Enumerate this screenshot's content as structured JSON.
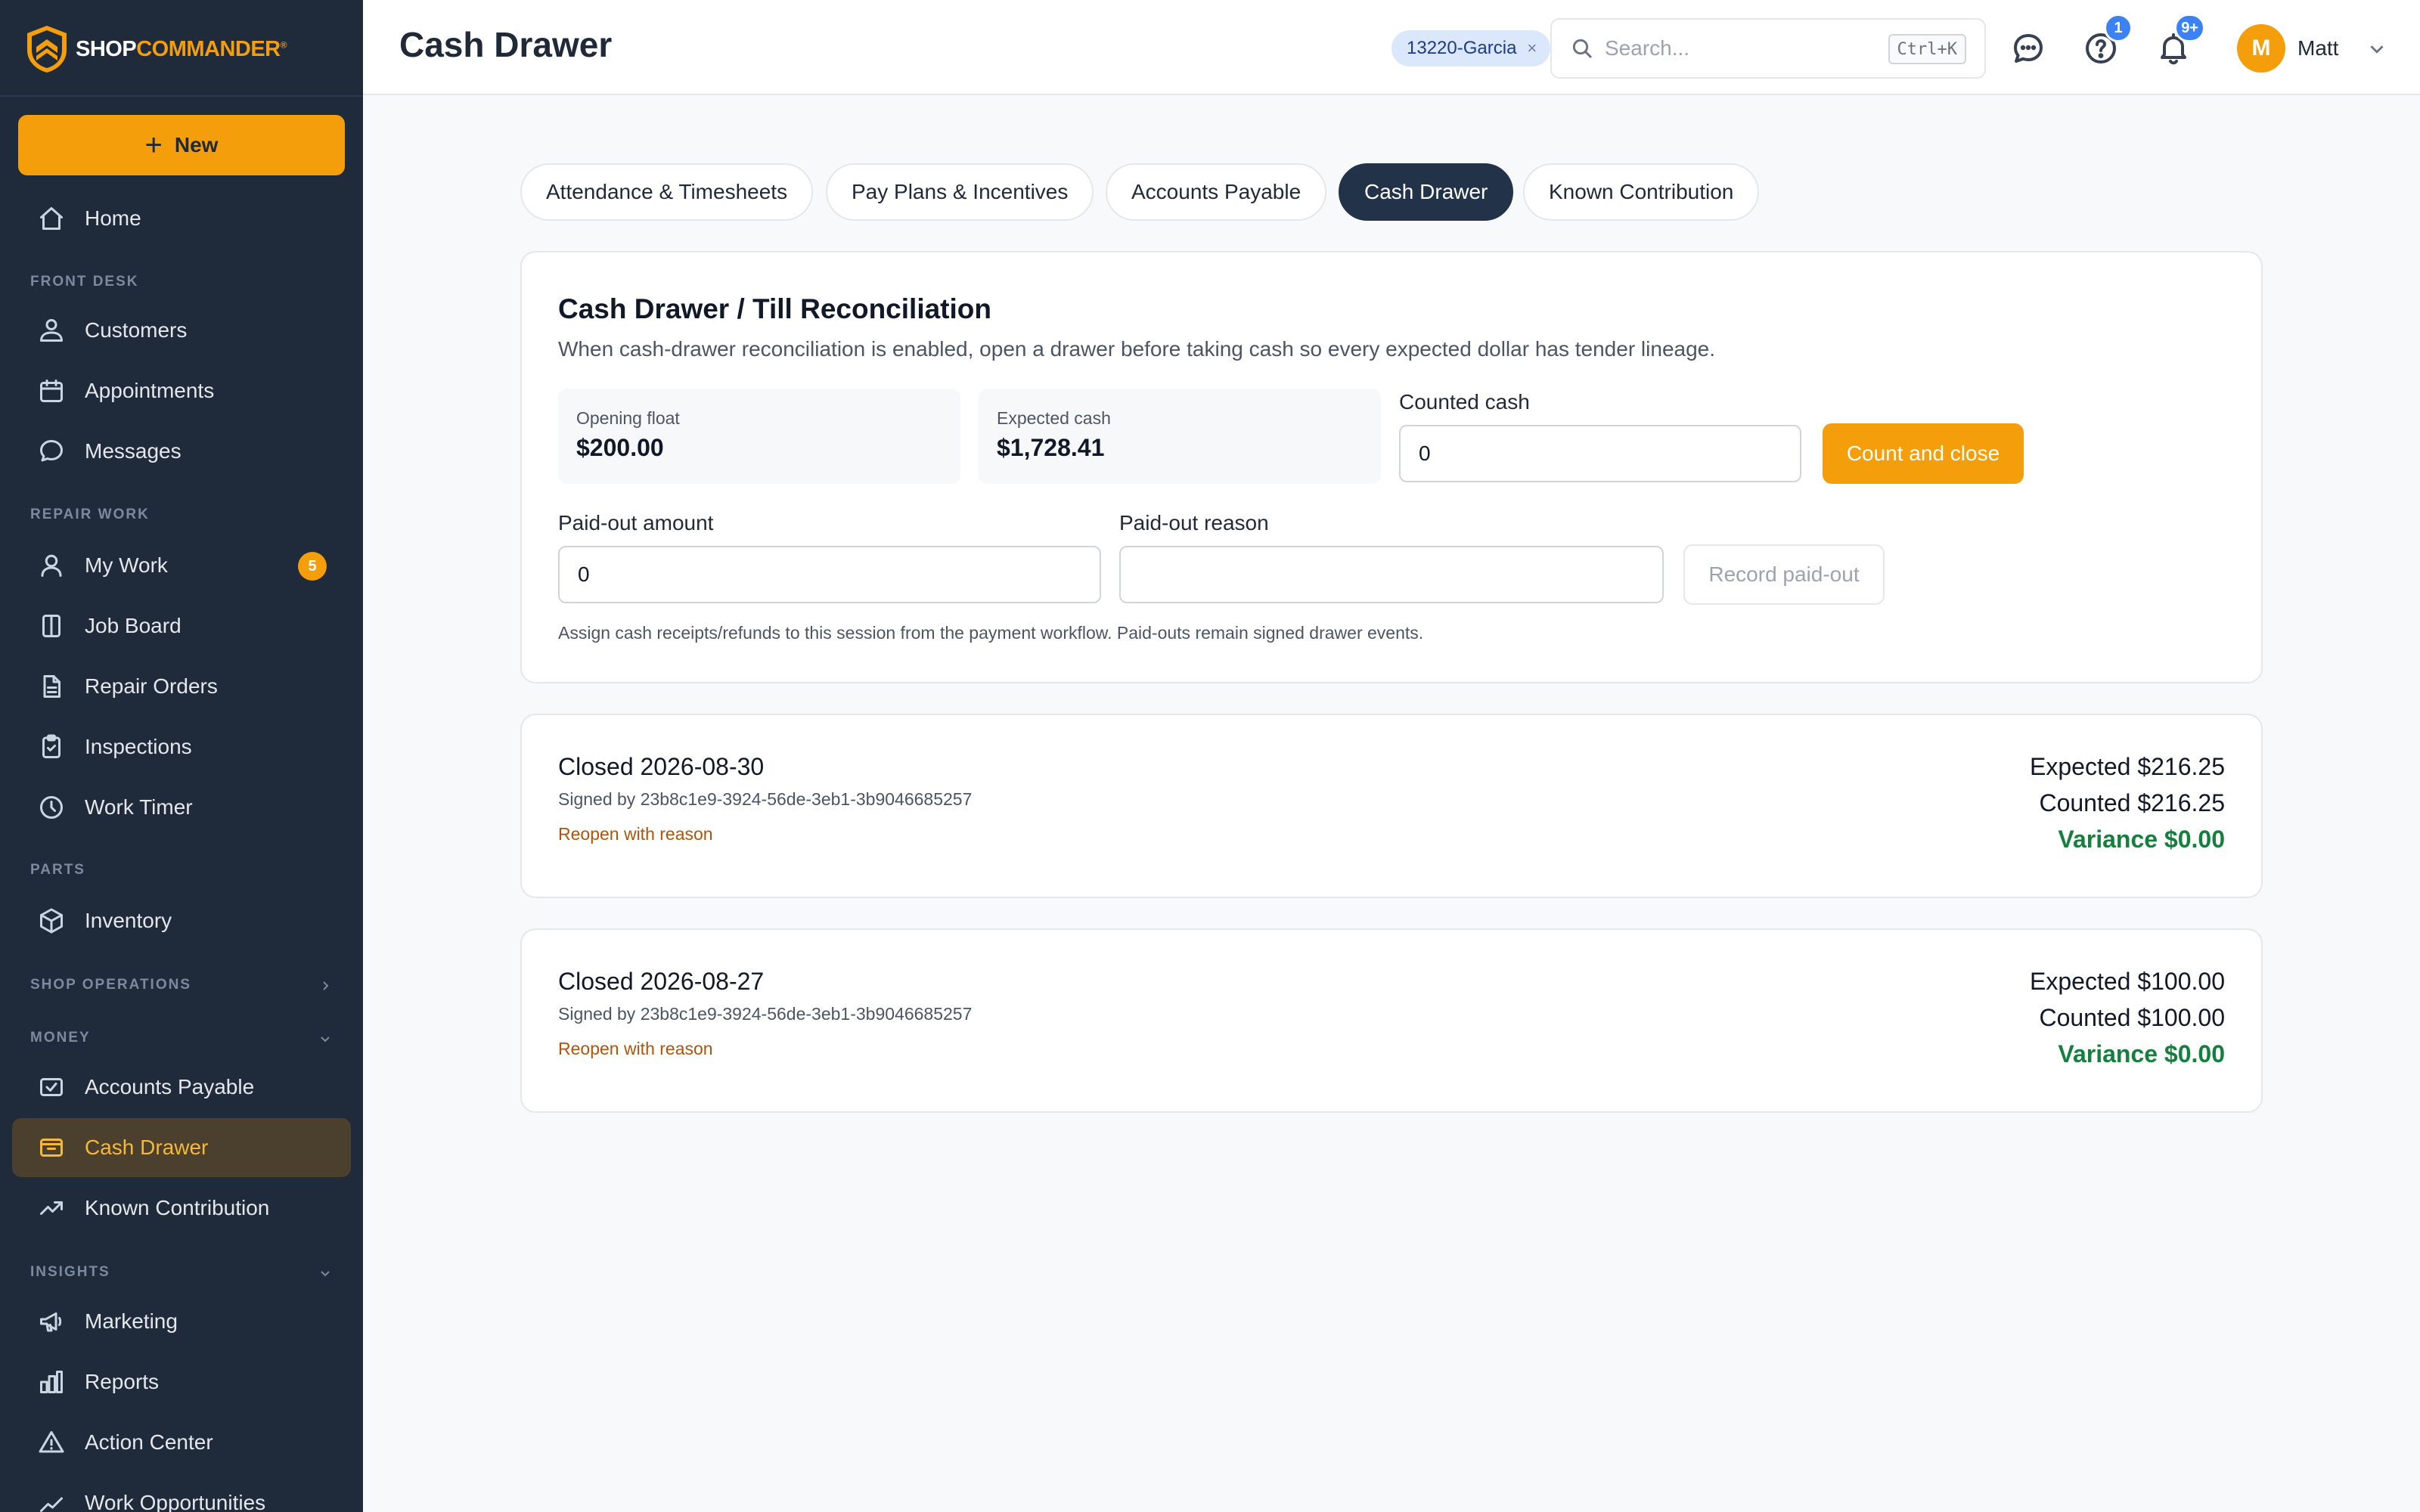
{
  "brand": {
    "part1": "SHOP",
    "part2": "COMMANDER",
    "mark": "®"
  },
  "sidebar": {
    "new_label": "New",
    "home": "Home",
    "sections": {
      "front_desk": "FRONT DESK",
      "repair_work": "REPAIR WORK",
      "parts": "PARTS",
      "shop_operations": "SHOP OPERATIONS",
      "money": "MONEY",
      "insights": "INSIGHTS"
    },
    "items": {
      "customers": "Customers",
      "appointments": "Appointments",
      "messages": "Messages",
      "my_work": "My Work",
      "my_work_badge": "5",
      "job_board": "Job Board",
      "repair_orders": "Repair Orders",
      "inspections": "Inspections",
      "work_timer": "Work Timer",
      "inventory": "Inventory",
      "accounts_payable": "Accounts Payable",
      "cash_drawer": "Cash Drawer",
      "known_contribution": "Known Contribution",
      "marketing": "Marketing",
      "reports": "Reports",
      "action_center": "Action Center",
      "work_opportunities": "Work Opportunities"
    }
  },
  "header": {
    "title": "Cash Drawer",
    "filter_chip": "13220-Garcia",
    "chip_close": "×",
    "search_placeholder": "Search...",
    "search_shortcut": "Ctrl+K",
    "help_badge": "1",
    "notifications_badge": "9+",
    "user_initial": "M",
    "user_name": "Matt"
  },
  "tabs": [
    {
      "label": "Attendance & Timesheets"
    },
    {
      "label": "Pay Plans & Incentives"
    },
    {
      "label": "Accounts Payable"
    },
    {
      "label": "Cash Drawer"
    },
    {
      "label": "Known Contribution"
    }
  ],
  "reconciliation": {
    "title": "Cash Drawer / Till Reconciliation",
    "subtitle": "When cash-drawer reconciliation is enabled, open a drawer before taking cash so every expected dollar has tender lineage.",
    "opening_float_label": "Opening float",
    "opening_float_value": "$200.00",
    "expected_cash_label": "Expected cash",
    "expected_cash_value": "$1,728.41",
    "counted_cash_label": "Counted cash",
    "counted_cash_value": "0",
    "count_close_label": "Count and close",
    "paid_out_amount_label": "Paid-out amount",
    "paid_out_amount_value": "0",
    "paid_out_reason_label": "Paid-out reason",
    "paid_out_reason_value": "",
    "record_paid_out_label": "Record paid-out",
    "note": "Assign cash receipts/refunds to this session from the payment workflow. Paid-outs remain signed drawer events."
  },
  "sessions": [
    {
      "title": "Closed 2026-08-30",
      "signed": "Signed by 23b8c1e9-3924-56de-3eb1-3b9046685257",
      "reopen": "Reopen with reason",
      "expected": "Expected $216.25",
      "counted": "Counted $216.25",
      "variance": "Variance $0.00"
    },
    {
      "title": "Closed 2026-08-27",
      "signed": "Signed by 23b8c1e9-3924-56de-3eb1-3b9046685257",
      "reopen": "Reopen with reason",
      "expected": "Expected $100.00",
      "counted": "Counted $100.00",
      "variance": "Variance $0.00"
    }
  ],
  "colors": {
    "sidebar_bg": "#1f2a3b",
    "accent": "#f59e0b",
    "active_tab": "#223249",
    "variance_ok": "#15803d",
    "reopen_link": "#b45309",
    "badge_blue": "#3b82f6"
  }
}
